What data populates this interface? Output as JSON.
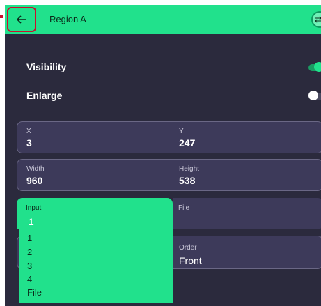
{
  "header": {
    "title": "Region A"
  },
  "settings": {
    "visibility": {
      "label": "Visibility",
      "on": true
    },
    "enlarge": {
      "label": "Enlarge",
      "on": false
    }
  },
  "position": {
    "x_label": "X",
    "x_value": "3",
    "y_label": "Y",
    "y_value": "247"
  },
  "size": {
    "width_label": "Width",
    "width_value": "960",
    "height_label": "Height",
    "height_value": "538"
  },
  "input": {
    "label": "Input",
    "value": "1",
    "options": [
      "1",
      "2",
      "3",
      "4",
      "File"
    ]
  },
  "file": {
    "label": "File"
  },
  "order": {
    "label": "Order",
    "value": "Front"
  },
  "colors": {
    "accent": "#21e18c",
    "background": "#2b2a3d",
    "field": "#3d3a5a",
    "annotation": "#c8102e"
  },
  "icons": {
    "back": "arrow-left-icon",
    "swap": "swap-icon"
  }
}
